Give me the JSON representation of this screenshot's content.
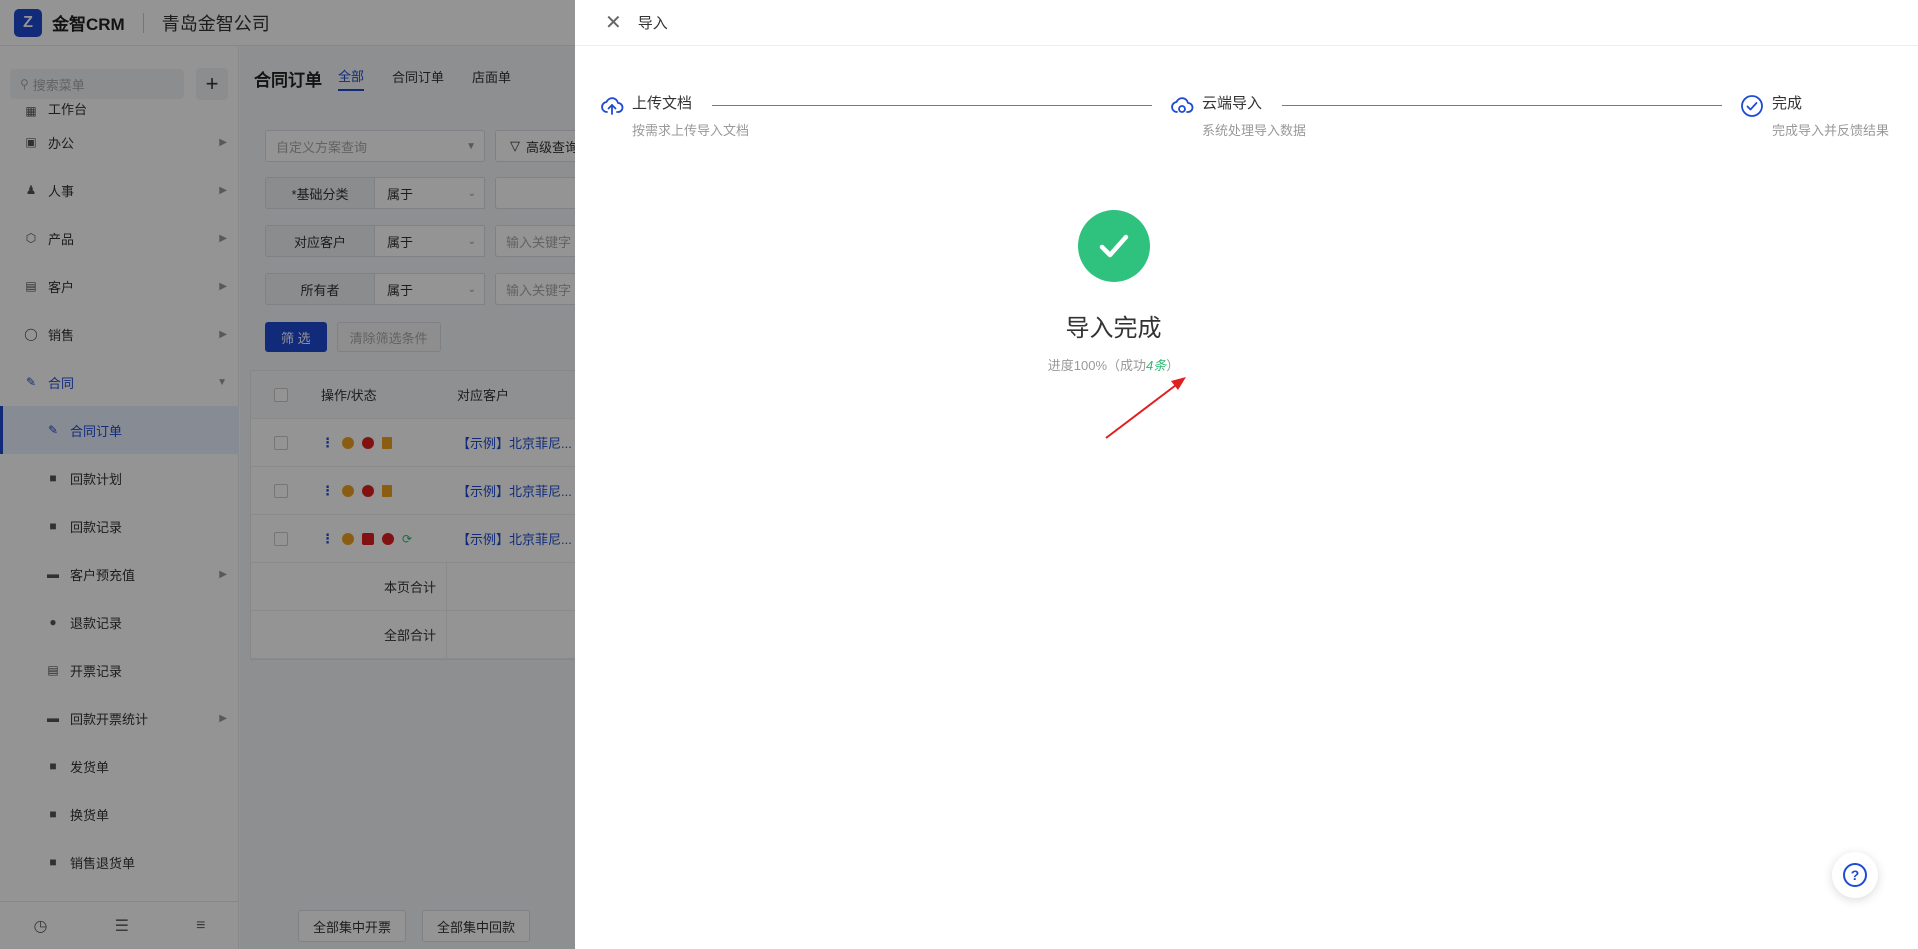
{
  "app": {
    "logo_mark": "Z",
    "brand": "金智CRM",
    "company": "青岛金智公司"
  },
  "sidebar": {
    "search_placeholder": "搜索菜单",
    "add_symbol": "+",
    "partial_item": "工作台",
    "items": [
      {
        "label": "办公",
        "has_arrow": true
      },
      {
        "label": "人事",
        "has_arrow": true
      },
      {
        "label": "产品",
        "has_arrow": true
      },
      {
        "label": "客户",
        "has_arrow": true
      },
      {
        "label": "销售",
        "has_arrow": true
      },
      {
        "label": "合同",
        "expanded": true
      }
    ],
    "sub_items": [
      {
        "label": "合同订单",
        "active": true
      },
      {
        "label": "回款计划"
      },
      {
        "label": "回款记录"
      },
      {
        "label": "客户预充值",
        "has_arrow": true
      },
      {
        "label": "退款记录"
      },
      {
        "label": "开票记录"
      },
      {
        "label": "回款开票统计",
        "has_arrow": true
      },
      {
        "label": "发货单"
      },
      {
        "label": "换货单"
      },
      {
        "label": "销售退货单"
      }
    ]
  },
  "main": {
    "page_title": "合同订单",
    "tabs": [
      "全部",
      "合同订单",
      "店面单"
    ],
    "custom_query_placeholder": "自定义方案查询",
    "advanced_query": "高级查询",
    "filters": [
      {
        "label": "*基础分类",
        "op": "属于",
        "value": ""
      },
      {
        "label": "对应客户",
        "op": "属于",
        "value": "输入关键字"
      },
      {
        "label": "所有者",
        "op": "属于",
        "value": "输入关键字"
      }
    ],
    "filter_button": "筛 选",
    "clear_button": "清除筛选条件",
    "table": {
      "headers": [
        "操作/状态",
        "对应客户"
      ],
      "rows": [
        {
          "customer": "【示例】北京菲尼..."
        },
        {
          "customer": "【示例】北京菲尼..."
        },
        {
          "customer": "【示例】北京菲尼..."
        }
      ],
      "page_total": "本页合计",
      "all_total": "全部合计"
    },
    "bottom_buttons": [
      "全部集中开票",
      "全部集中回款"
    ]
  },
  "drawer": {
    "title": "导入",
    "steps": [
      {
        "title": "上传文档",
        "desc": "按需求上传导入文档"
      },
      {
        "title": "云端导入",
        "desc": "系统处理导入数据"
      },
      {
        "title": "完成",
        "desc": "完成导入并反馈结果"
      }
    ],
    "result_title": "导入完成",
    "progress_prefix": "进度100%（成功",
    "success_count": "4条",
    "progress_suffix": "）",
    "help_symbol": "?"
  },
  "colors": {
    "brand": "#1e4bd2",
    "success": "#2ec27e",
    "arrow": "#e02020"
  }
}
